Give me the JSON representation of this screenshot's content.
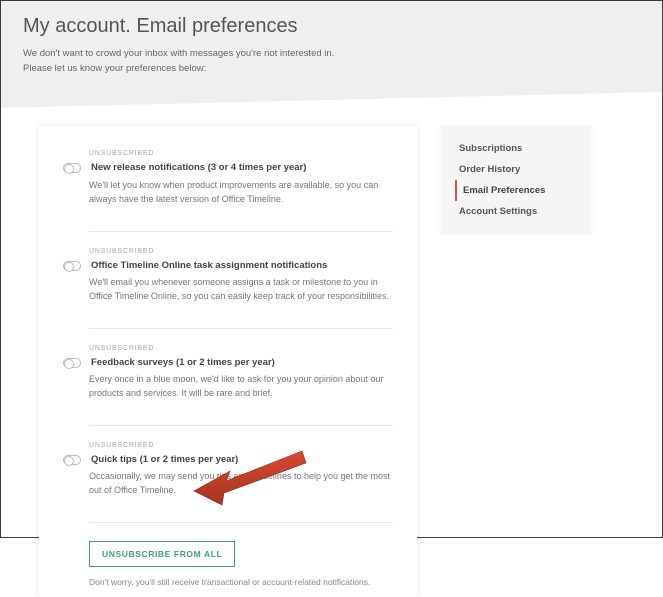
{
  "header": {
    "title": "My account. Email preferences",
    "sub1": "We don't want to crowd your inbox with messages you're not interested in.",
    "sub2": "Please let us know your preferences below:"
  },
  "prefs": [
    {
      "status": "UNSUBSCRIBED",
      "title": "New release notifications (3 or 4 times per year)",
      "desc": "We'll let you know when product improvements are available, so you can always have the latest version of Office Timeline."
    },
    {
      "status": "UNSUBSCRIBED",
      "title": "Office Timeline Online task assignment notifications",
      "desc": "We'll email you whenever someone assigns a task or milestone to you in Office Timeline Online, so you can easily keep track of your responsibilities."
    },
    {
      "status": "UNSUBSCRIBED",
      "title": "Feedback surveys (1 or 2 times per year)",
      "desc": "Every once in a blue moon, we'd like to ask for you your opinion about our products and services. It will be rare and brief."
    },
    {
      "status": "UNSUBSCRIBED",
      "title": "Quick tips (1 or 2 times per year)",
      "desc": "Occasionally, we may send you tips and guidelines to help you get the most out of Office Timeline."
    }
  ],
  "unsub_button": "UNSUBSCRIBE FROM ALL",
  "footnote": "Don't worry, you'll still receive transactional or account-related notifications.",
  "sidebar": [
    {
      "label": "Subscriptions",
      "active": false
    },
    {
      "label": "Order History",
      "active": false
    },
    {
      "label": "Email Preferences",
      "active": true
    },
    {
      "label": "Account Settings",
      "active": false
    }
  ]
}
